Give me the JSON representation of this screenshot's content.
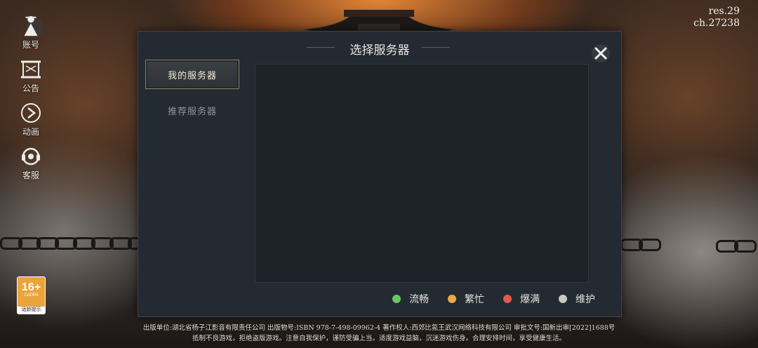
{
  "version": {
    "res": "res.29",
    "ch": "ch.27238"
  },
  "side_menu": [
    {
      "id": "account",
      "label": "账号",
      "icon": "figure-icon"
    },
    {
      "id": "notice",
      "label": "公告",
      "icon": "scroll-icon"
    },
    {
      "id": "animation",
      "label": "动画",
      "icon": "play-icon"
    },
    {
      "id": "service",
      "label": "客服",
      "icon": "headset-icon"
    }
  ],
  "age_badge": {
    "age": "16+",
    "org": "CADPA",
    "tip": "适龄提示"
  },
  "dialog": {
    "title": "选择服务器",
    "close_icon": "close-icon",
    "tabs": [
      {
        "label": "我的服务器",
        "active": true
      },
      {
        "label": "推荐服务器",
        "active": false
      }
    ]
  },
  "legend": [
    {
      "label": "流畅",
      "color": "#6ac46a"
    },
    {
      "label": "繁忙",
      "color": "#e8a94a"
    },
    {
      "label": "爆满",
      "color": "#e05a55"
    },
    {
      "label": "维护",
      "color": "#c9c9c2"
    }
  ],
  "footer": {
    "line1": "出版单位:湖北省杨子江影音有限责任公司 出版物号:ISBN 978-7-498-09962-4 著作权人:西郊比氪王武汉网络科技有限公司 审批文号:国新出审[2022]1688号",
    "line2": "抵制不良游戏，拒绝盗版游戏。注意自我保护，谨防受骗上当。适度游戏益脑，沉迷游戏伤身。合理安排时间，享受健康生活。"
  },
  "colors": {
    "dialog_bg": "#232a31",
    "active_tab_border": "#8b826b"
  }
}
